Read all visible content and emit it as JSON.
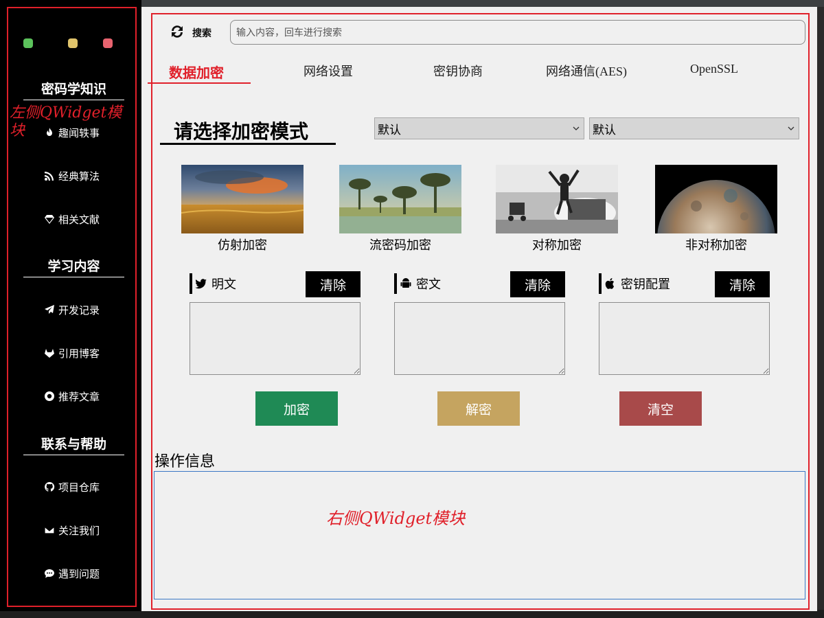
{
  "colors": {
    "sidebar_bg": "#000000",
    "panel_bg": "#f0f0f0",
    "accent_red": "#e0202a",
    "encrypt_btn": "#1f8a55",
    "decrypt_btn": "#c5a460",
    "clear_all_btn": "#a84a4a"
  },
  "window_dots": [
    "green",
    "yellow",
    "red"
  ],
  "sidebar": {
    "annotation": "左侧QWidget模块",
    "sections": [
      {
        "title": "密码学知识",
        "items": [
          {
            "label": "趣闻轶事",
            "icon": "fire-icon"
          },
          {
            "label": "经典算法",
            "icon": "rss-icon"
          },
          {
            "label": "相关文献",
            "icon": "diamond-icon"
          }
        ]
      },
      {
        "title": "学习内容",
        "items": [
          {
            "label": "开发记录",
            "icon": "paper-plane-icon"
          },
          {
            "label": "引用博客",
            "icon": "gitlab-icon"
          },
          {
            "label": "推荐文章",
            "icon": "firefox-icon"
          }
        ]
      },
      {
        "title": "联系与帮助",
        "items": [
          {
            "label": "项目仓库",
            "icon": "github-icon"
          },
          {
            "label": "关注我们",
            "icon": "envelope-icon"
          },
          {
            "label": "遇到问题",
            "icon": "comment-icon"
          }
        ]
      }
    ]
  },
  "search": {
    "label": "搜索",
    "placeholder": "输入内容，回车进行搜索",
    "icon": "refresh-icon"
  },
  "tabs": [
    {
      "label": "数据加密",
      "active": true
    },
    {
      "label": "网络设置",
      "active": false
    },
    {
      "label": "密钥协商",
      "active": false
    },
    {
      "label": "网络通信(AES)",
      "active": false
    },
    {
      "label": "OpenSSL",
      "active": false
    }
  ],
  "mode": {
    "title": "请选择加密模式",
    "select1": "默认",
    "select2": "默认",
    "cards": [
      {
        "caption": "仿射加密"
      },
      {
        "caption": "流密码加密"
      },
      {
        "caption": "对称加密"
      },
      {
        "caption": "非对称加密"
      }
    ]
  },
  "fields": [
    {
      "label": "明文",
      "clear": "清除",
      "icon": "twitter-icon"
    },
    {
      "label": "密文",
      "clear": "清除",
      "icon": "android-icon"
    },
    {
      "label": "密钥配置",
      "clear": "清除",
      "icon": "apple-icon"
    }
  ],
  "actions": {
    "encrypt": "加密",
    "decrypt": "解密",
    "clear_all": "清空"
  },
  "info": {
    "label": "操作信息",
    "annotation": "右侧QWidget模块"
  }
}
